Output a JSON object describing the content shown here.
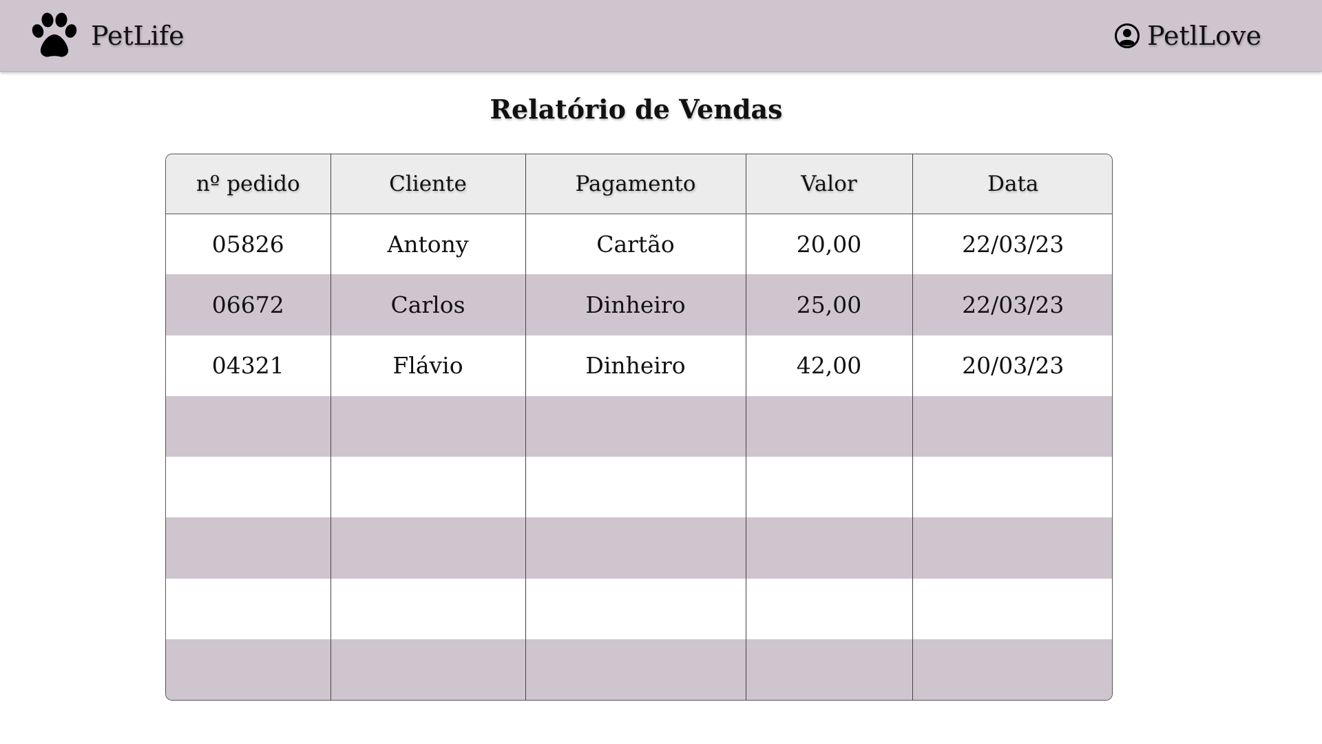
{
  "header": {
    "brand_icon": "paw-icon",
    "brand_name": "PetLife",
    "user_icon": "user-circle-icon",
    "user_name": "PetlLove",
    "bar_color": "#cfc5cf"
  },
  "page": {
    "title": "Relatório de Vendas"
  },
  "table": {
    "columns": [
      "nº pedido",
      "Cliente",
      "Pagamento",
      "Valor",
      "Data"
    ],
    "rows": [
      [
        "05826",
        "Antony",
        "Cartão",
        "20,00",
        "22/03/23"
      ],
      [
        "06672",
        "Carlos",
        "Dinheiro",
        "25,00",
        "22/03/23"
      ],
      [
        "04321",
        "Flávio",
        "Dinheiro",
        "42,00",
        "20/03/23"
      ],
      [
        "",
        "",
        "",
        "",
        ""
      ],
      [
        "",
        "",
        "",
        "",
        ""
      ],
      [
        "",
        "",
        "",
        "",
        ""
      ],
      [
        "",
        "",
        "",
        "",
        ""
      ],
      [
        "",
        "",
        "",
        "",
        ""
      ]
    ],
    "stripe_color": "#cfc5cf",
    "header_color": "#ececec"
  }
}
